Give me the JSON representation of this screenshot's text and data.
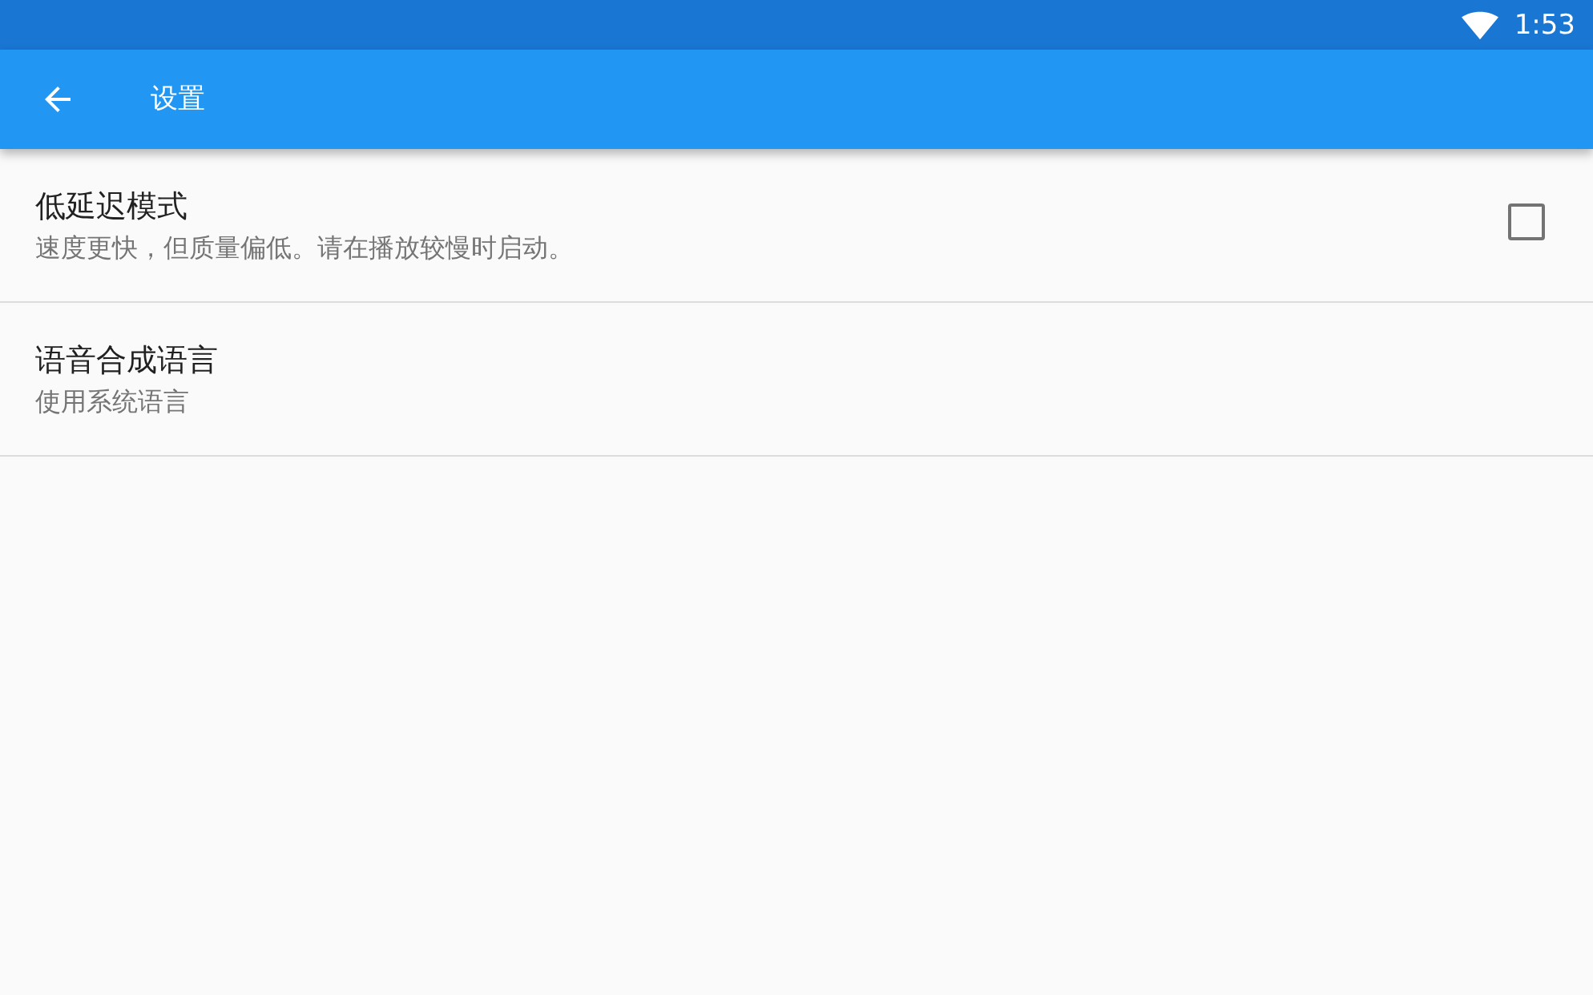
{
  "status_bar": {
    "time": "1:53"
  },
  "app_bar": {
    "title": "设置"
  },
  "settings": [
    {
      "kind": "checkbox",
      "title": "低延迟模式",
      "summary": "速度更快，但质量偏低。请在播放较慢时启动。",
      "checked": false
    },
    {
      "kind": "plain",
      "title": "语音合成语言",
      "summary": "使用系统语言"
    }
  ]
}
